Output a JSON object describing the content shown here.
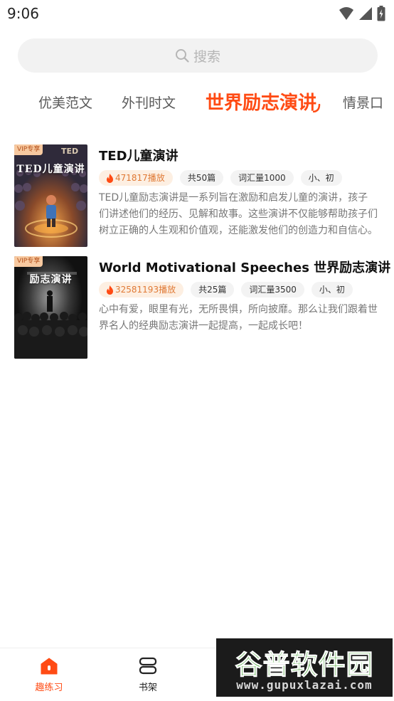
{
  "status_bar": {
    "time": "9:06"
  },
  "search": {
    "placeholder": "搜索"
  },
  "tabs": [
    {
      "label": "优美范文",
      "active": false
    },
    {
      "label": "外刊时文",
      "active": false
    },
    {
      "label": "世界励志演讲",
      "active": true
    },
    {
      "label": "情景口",
      "active": false
    }
  ],
  "books": [
    {
      "title": "TED儿童演讲",
      "badge": "VIP专享",
      "cover_title": "TED儿童演讲",
      "cover_logo": "TED",
      "plays": "471817播放",
      "count": "共50篇",
      "vocab": "词汇量1000",
      "level": "小、初",
      "description": "TED儿童励志演讲是一系列旨在激励和启发儿童的演讲，孩子们讲述他们的经历、见解和故事。这些演讲不仅能够帮助孩子们树立正确的人生观和价值观，还能激发他们的创造力和自信心。"
    },
    {
      "title": "World Motivational Speeches 世界励志演讲",
      "badge": "VIP专享",
      "cover_title": "励志演讲",
      "plays": "32581193播放",
      "count": "共25篇",
      "vocab": "词汇量3500",
      "level": "小、初",
      "description": "心中有爱，眼里有光，无所畏惧，所向披靡。那么让我们跟着世界名人的经典励志演讲一起提高，一起成长吧！"
    }
  ],
  "bottom_nav": [
    {
      "label": "趣练习",
      "icon": "home-icon",
      "active": true
    },
    {
      "label": "书架",
      "icon": "bookshelf-icon",
      "active": false
    }
  ],
  "watermark": {
    "main": "谷普软件园",
    "sub": "www.gupuxlazai.com"
  },
  "colors": {
    "accent": "#ff4b14",
    "hot_tag_bg": "#fdefe2",
    "hot_tag_text": "#e07a36"
  }
}
